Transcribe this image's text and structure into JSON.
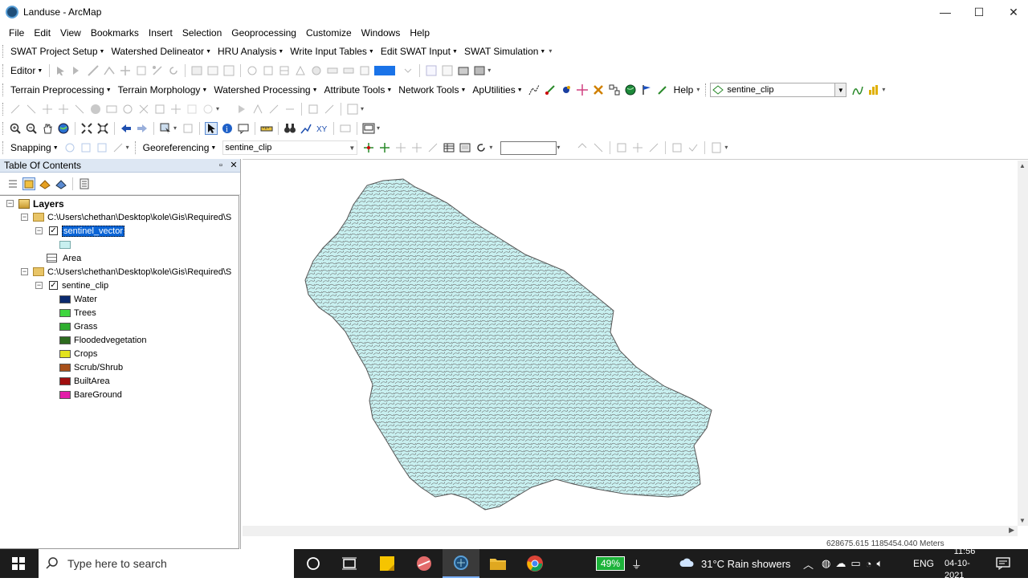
{
  "window": {
    "title": "Landuse - ArcMap",
    "minimize": "—",
    "maximize": "☐",
    "close": "✕"
  },
  "menu": [
    "File",
    "Edit",
    "View",
    "Bookmarks",
    "Insert",
    "Selection",
    "Geoprocessing",
    "Customize",
    "Windows",
    "Help"
  ],
  "swat_toolbar": [
    "SWAT Project Setup",
    "Watershed Delineator",
    "HRU Analysis",
    "Write Input Tables",
    "Edit SWAT Input",
    "SWAT Simulation"
  ],
  "editor_toolbar": {
    "editor_label": "Editor"
  },
  "archydro_toolbar": {
    "items": [
      "Terrain Preprocessing",
      "Terrain Morphology",
      "Watershed Processing",
      "Attribute Tools",
      "Network Tools",
      "ApUtilities"
    ],
    "help_label": "Help",
    "layer_combo": "sentine_clip"
  },
  "snapping_toolbar": {
    "snapping_label": "Snapping",
    "georeferencing_label": "Georeferencing",
    "georef_layer": "sentine_clip"
  },
  "toc": {
    "title": "Table Of Contents",
    "layers_label": "Layers",
    "group1_path": "C:\\Users\\chethan\\Desktop\\kole\\Gis\\Required\\S",
    "layer1_name": "sentinel_vector",
    "layer1_field": "Area",
    "group2_path": "C:\\Users\\chethan\\Desktop\\kole\\Gis\\Required\\S",
    "layer2_name": "sentine_clip",
    "classes": [
      {
        "label": "Water",
        "color": "#0b2a6e"
      },
      {
        "label": "Trees",
        "color": "#3fd63f"
      },
      {
        "label": "Grass",
        "color": "#2fae2f"
      },
      {
        "label": "Floodedvegetation",
        "color": "#2d6b1f"
      },
      {
        "label": "Crops",
        "color": "#e3e31e"
      },
      {
        "label": "Scrub/Shrub",
        "color": "#a8501a"
      },
      {
        "label": "BuiltArea",
        "color": "#a00f0f"
      },
      {
        "label": "BareGround",
        "color": "#e31ca8"
      }
    ],
    "layer1_symbol_color": "#c8f0f0"
  },
  "map": {
    "fill_color": "#c8f0f0",
    "stroke_color": "#555555",
    "coordinates": "628675.615  1185454.040 Meters"
  },
  "taskbar": {
    "search_placeholder": "Type here to search",
    "battery": "49%",
    "weather": "31°C  Rain showers",
    "language": "ENG",
    "time": "11:56",
    "date": "04-10-2021"
  }
}
